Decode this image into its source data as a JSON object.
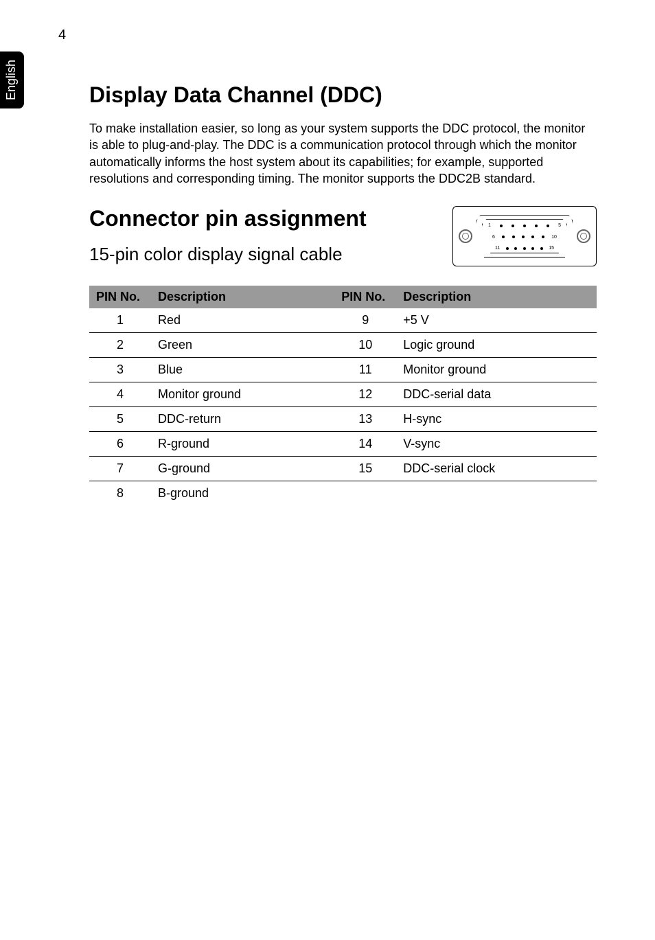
{
  "page_number": "4",
  "side_tab": "English",
  "heading1": "Display Data Channel (DDC)",
  "paragraph": "To make installation easier, so long as your system supports the DDC protocol, the monitor is able to plug-and-play. The DDC is a communication protocol through which the monitor automatically informs the host system about its capabilities; for example, supported resolutions and corresponding timing. The monitor supports the DDC2B standard.",
  "heading2": "Connector pin assignment",
  "subheading": "15-pin color display signal cable",
  "connector_labels": {
    "r1_left": "1",
    "r1_right": "5",
    "r2_left": "6",
    "r2_right": "10",
    "r3_left": "11",
    "r3_right": "15"
  },
  "table": {
    "headers": {
      "pin": "PIN No.",
      "desc": "Description"
    },
    "rows": [
      {
        "p1": "1",
        "d1": "Red",
        "p2": "9",
        "d2": "+5 V"
      },
      {
        "p1": "2",
        "d1": "Green",
        "p2": "10",
        "d2": "Logic ground"
      },
      {
        "p1": "3",
        "d1": "Blue",
        "p2": "11",
        "d2": "Monitor ground"
      },
      {
        "p1": "4",
        "d1": "Monitor ground",
        "p2": "12",
        "d2": "DDC-serial data"
      },
      {
        "p1": "5",
        "d1": "DDC-return",
        "p2": "13",
        "d2": "H-sync"
      },
      {
        "p1": "6",
        "d1": "R-ground",
        "p2": "14",
        "d2": "V-sync"
      },
      {
        "p1": "7",
        "d1": "G-ground",
        "p2": "15",
        "d2": "DDC-serial clock"
      },
      {
        "p1": "8",
        "d1": "B-ground",
        "p2": "",
        "d2": ""
      }
    ]
  }
}
